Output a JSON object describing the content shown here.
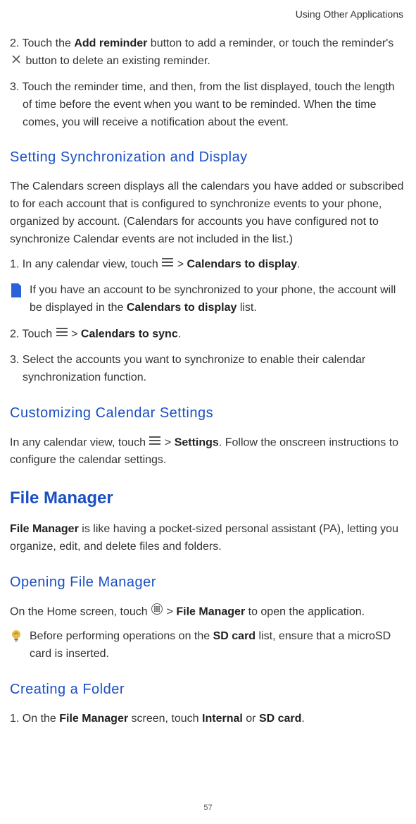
{
  "header": {
    "chapter": "Using Other Applications"
  },
  "footer": {
    "page_number": "57"
  },
  "sec1": {
    "step2_a": "2. Touch the ",
    "step2_b": "Add reminder",
    "step2_c": " button to add a reminder, or touch the reminder's ",
    "step2_d": " button to delete an existing reminder.",
    "step3": "3. Touch the reminder time, and then, from the list displayed, touch the length of time before the event when you want to be reminded. When the time comes, you will receive a notification about the event."
  },
  "sync": {
    "heading": "Setting Synchronization and Display",
    "intro": "The Calendars screen displays all the calendars you have added or subscribed to for each account that is configured to synchronize events to your phone, organized by account. (Calendars for accounts you have configured not to synchronize Calendar events are not included in the list.)",
    "s1_a": "1. In any calendar view, touch ",
    "s1_b": " > ",
    "s1_c": "Calendars to display",
    "s1_d": ".",
    "note1_a": "If you have an account to be synchronized to your phone, the account will be displayed in the ",
    "note1_b": "Calendars to display",
    "note1_c": " list.",
    "s2_a": "2. Touch ",
    "s2_b": " > ",
    "s2_c": "Calendars to sync",
    "s2_d": ".",
    "s3": "3. Select the accounts you want to synchronize to enable their calendar synchronization function."
  },
  "custom": {
    "heading": "Customizing Calendar Settings",
    "p_a": " In any calendar view, touch ",
    "p_b": " > ",
    "p_c": "Settings",
    "p_d": ". Follow the onscreen instructions to configure the calendar settings."
  },
  "fm": {
    "heading": "File Manager",
    "intro_a": "File Manager",
    "intro_b": " is like having a pocket-sized personal assistant (PA), letting you organize, edit, and delete files and folders.",
    "open_heading": "Opening File Manager",
    "open_a": "On the Home screen, touch ",
    "open_b": " > ",
    "open_c": "File Manager",
    "open_d": " to open the application.",
    "note_a": "Before performing operations on the ",
    "note_b": "SD card",
    "note_c": " list, ensure that a microSD card is inserted.",
    "create_heading": "Creating a Folder",
    "create_s1_a": "1. On the ",
    "create_s1_b": "File Manager",
    "create_s1_c": " screen, touch ",
    "create_s1_d": "Internal",
    "create_s1_e": " or ",
    "create_s1_f": "SD card",
    "create_s1_g": "."
  }
}
